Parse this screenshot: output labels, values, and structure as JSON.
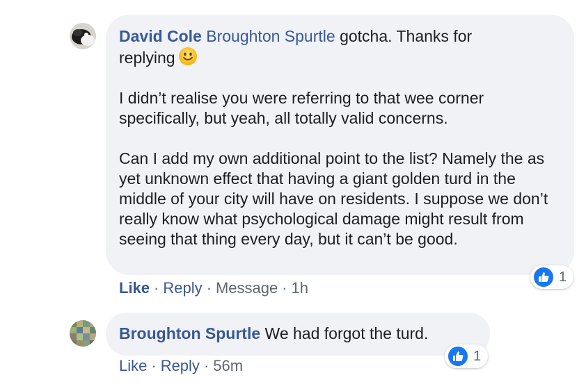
{
  "comments": [
    {
      "author": "David Cole",
      "mention": "Broughton Spurtle",
      "first_line_text": "gotcha. Thanks for",
      "second_line_text": "replying",
      "emoji": "slightly-smiling-face-icon",
      "paragraph_2": "I didn’t realise you were referring to that wee corner specifically, but yeah, all totally valid concerns.",
      "paragraph_3": "Can I add my own additional point to the list? Namely the as yet unknown effect that having a giant golden turd in the middle of your city will have on residents. I suppose we don’t really know what psychological damage might result from seeing that thing every day, but it can’t be good.",
      "actions": {
        "like": "Like",
        "reply": "Reply",
        "message": "Message",
        "time": "1h"
      },
      "reaction_count": "1"
    },
    {
      "author": "Broughton Spurtle",
      "text": "We had forgot the turd.",
      "actions": {
        "like": "Like",
        "reply": "Reply",
        "time": "56m"
      },
      "reaction_count": "1"
    }
  ],
  "separator": "·",
  "colors": {
    "link": "#385898",
    "bubble": "#f0f2f5",
    "like_blue": "#1877f2",
    "muted": "#606770"
  }
}
